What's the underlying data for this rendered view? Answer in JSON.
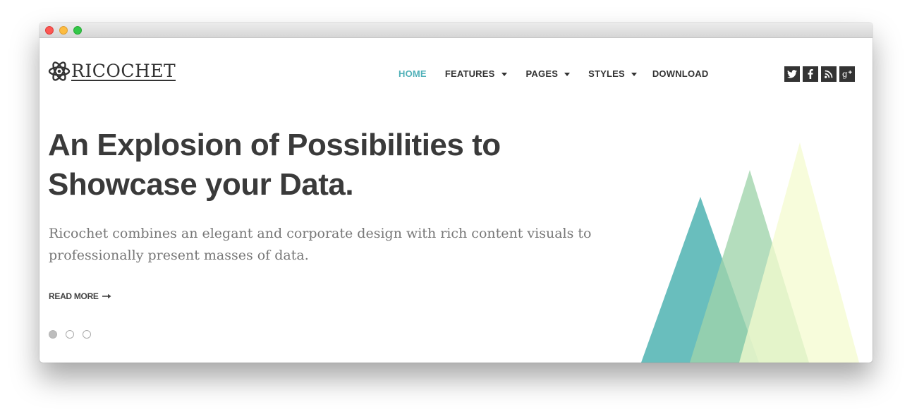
{
  "window": {
    "controls": [
      "close",
      "minimize",
      "zoom"
    ]
  },
  "logo": {
    "text": "RICOCHET",
    "icon": "atom-icon"
  },
  "nav": {
    "items": [
      {
        "label": "HOME",
        "active": true,
        "has_dropdown": false
      },
      {
        "label": "FEATURES",
        "active": false,
        "has_dropdown": true
      },
      {
        "label": "PAGES",
        "active": false,
        "has_dropdown": true
      },
      {
        "label": "STYLES",
        "active": false,
        "has_dropdown": true
      },
      {
        "label": "DOWNLOAD",
        "active": false,
        "has_dropdown": false
      }
    ]
  },
  "social": [
    {
      "name": "twitter",
      "icon": "twitter-icon"
    },
    {
      "name": "facebook",
      "icon": "facebook-icon"
    },
    {
      "name": "rss",
      "icon": "rss-icon"
    },
    {
      "name": "google-plus",
      "icon": "google-plus-icon"
    }
  ],
  "hero": {
    "title": "An Explosion of Possibilities to Showcase your Data.",
    "description": "Ricochet combines an elegant and corporate design with rich content visuals to professionally present masses of data.",
    "read_more": "READ MORE",
    "read_more_icon": "arrow-right-icon"
  },
  "slider": {
    "count": 3,
    "active_index": 0
  },
  "colors": {
    "accent": "#4fb0b8",
    "text_dark": "#3a3a3a",
    "icon_bg": "#333333",
    "triangle_teal": "#5cb8b7",
    "triangle_green": "#9fd3aa",
    "triangle_yellow": "#f4fbcf"
  }
}
